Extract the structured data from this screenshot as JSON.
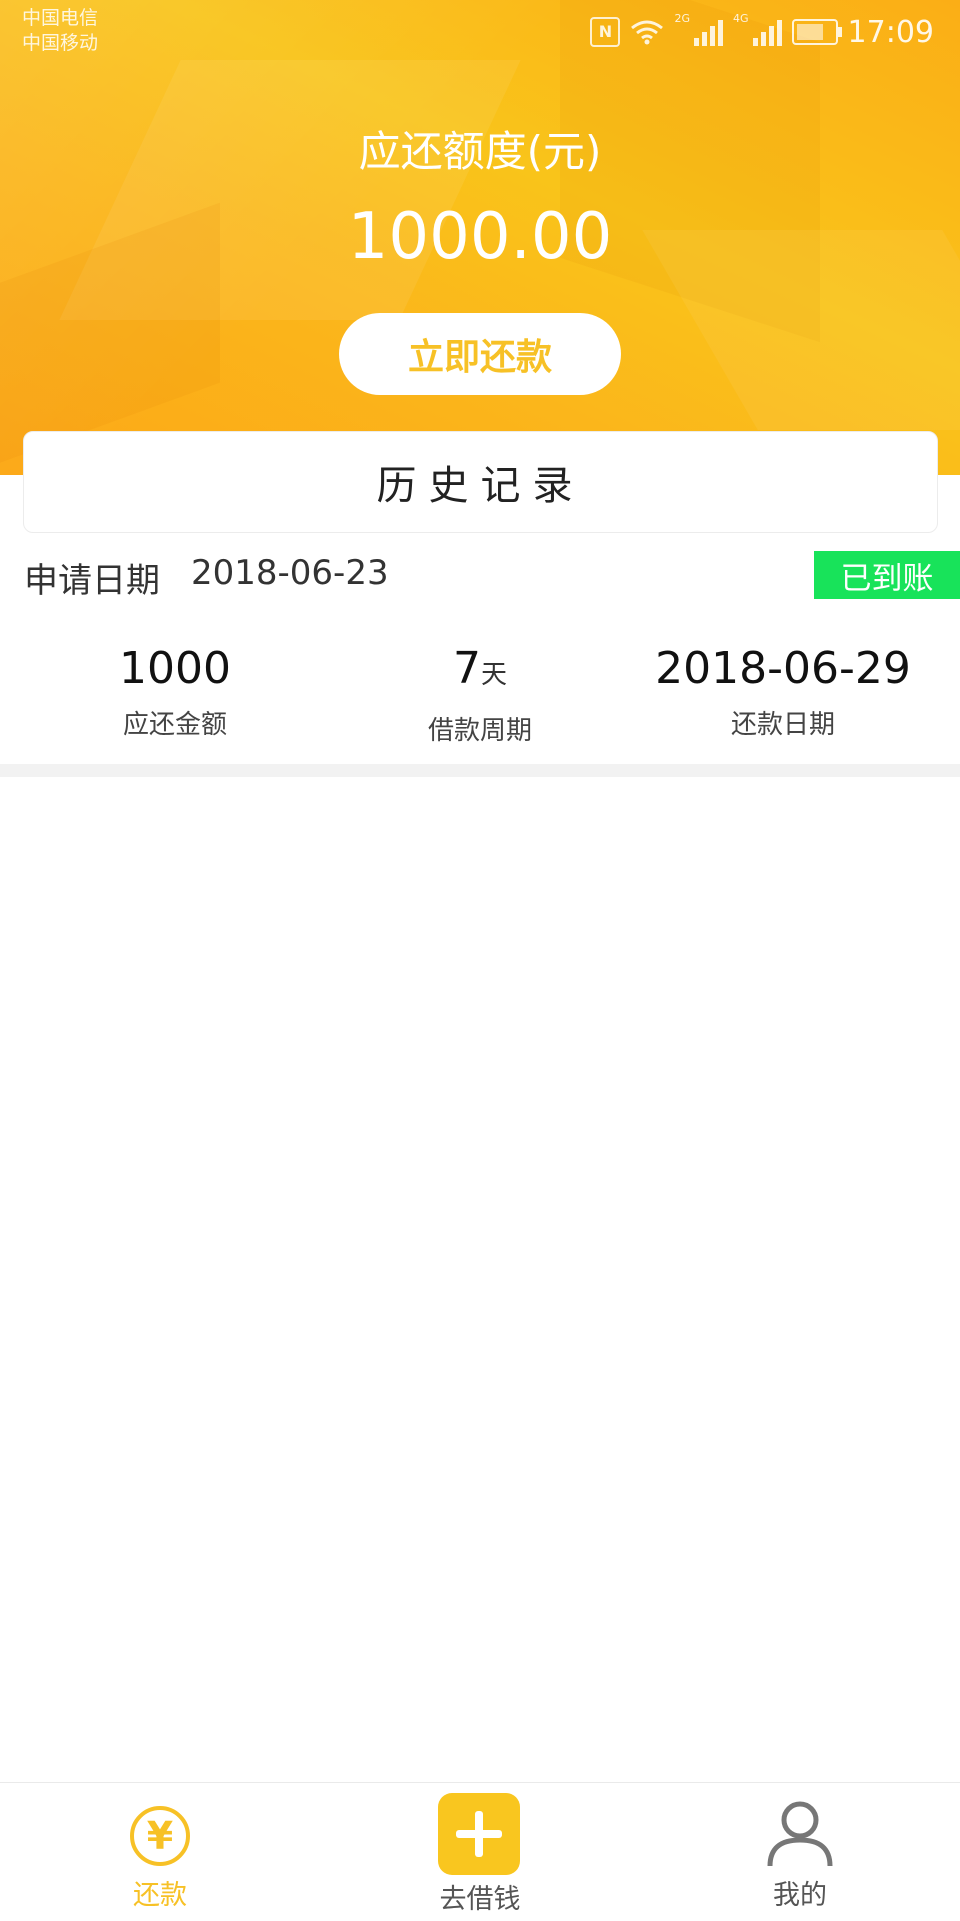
{
  "status_bar": {
    "carrier_1": "中国电信",
    "carrier_2": "中国移动",
    "net_2g": "2G",
    "net_4g": "4G",
    "time": "17:09"
  },
  "hero": {
    "amount_label": "应还额度(元)",
    "amount_value": "1000.00",
    "repay_button": "立即还款",
    "accent_color": "#fbb61b"
  },
  "history": {
    "title": "历史记录",
    "record": {
      "apply_label": "申请日期",
      "apply_date": "2018-06-23",
      "status": "已到账",
      "status_color": "#18e35a",
      "amount_value": "1000",
      "amount_label": "应还金额",
      "period_value": "7",
      "period_unit": "天",
      "period_label": "借款周期",
      "repay_date_value": "2018-06-29",
      "repay_date_label": "还款日期"
    }
  },
  "tabbar": {
    "tabs": [
      {
        "label": "还款",
        "icon": "yen-icon",
        "active": true,
        "color": "#f7c126"
      },
      {
        "label": "去借钱",
        "icon": "plus-icon",
        "active": false
      },
      {
        "label": "我的",
        "icon": "user-icon",
        "active": false
      }
    ]
  }
}
